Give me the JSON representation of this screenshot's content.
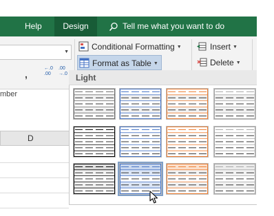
{
  "tabs": [
    {
      "label": "Help"
    },
    {
      "label": "Design"
    }
  ],
  "tellme": {
    "text": "Tell me what you want to do"
  },
  "ribbon": {
    "conditional_formatting": "Conditional Formatting",
    "format_as_table": "Format as Table",
    "insert": "Insert",
    "delete": "Delete",
    "comma": ",",
    "increase_decimal": "←.0\n.00",
    "decrease_decimal": ".00\n→.0",
    "number_group_label": "mber"
  },
  "sheet": {
    "column_header": "D"
  },
  "gallery": {
    "section": "Light",
    "styles": [
      {
        "color": "#6b6b6b",
        "banded": true,
        "header_fill": "#ffffff"
      },
      {
        "color": "#4472c4",
        "banded": true,
        "header_fill": "#ffffff"
      },
      {
        "color": "#ed7d31",
        "banded": true,
        "header_fill": "#ffffff"
      },
      {
        "color": "#a5a5a5",
        "banded": true,
        "header_fill": "#ffffff"
      },
      {
        "color": "#000000",
        "banded": false,
        "header_fill": "#ffffff"
      },
      {
        "color": "#4472c4",
        "banded": false,
        "header_fill": "#ffffff"
      },
      {
        "color": "#ed7d31",
        "banded": false,
        "header_fill": "#ffffff"
      },
      {
        "color": "#a5a5a5",
        "banded": false,
        "header_fill": "#ffffff"
      },
      {
        "color": "#000000",
        "banded": true,
        "header_fill": "#e0e0e0"
      },
      {
        "color": "#4472c4",
        "banded": true,
        "header_fill": "#c9d7ee",
        "selected": true
      },
      {
        "color": "#ed7d31",
        "banded": true,
        "header_fill": "#fbe0cd"
      },
      {
        "color": "#a5a5a5",
        "banded": true,
        "header_fill": "#ececec"
      }
    ]
  },
  "colors": {
    "ribbon_green": "#217346",
    "active_tab": "#185c37",
    "selected_button": "#c5d6ea"
  }
}
